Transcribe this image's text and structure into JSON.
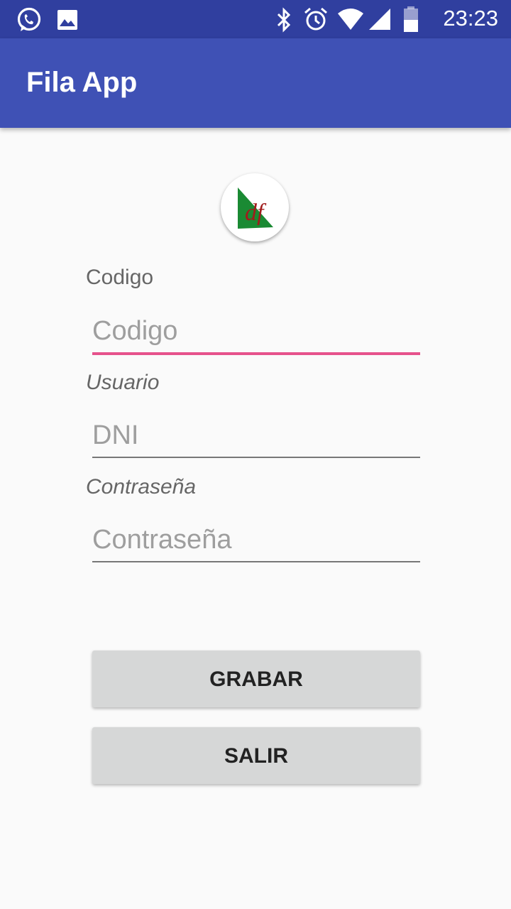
{
  "status_bar": {
    "time": "23:23",
    "icons": [
      "whatsapp-icon",
      "image-icon",
      "bluetooth-icon",
      "alarm-icon",
      "wifi-icon",
      "signal-icon",
      "battery-icon"
    ]
  },
  "app_bar": {
    "title": "Fila App"
  },
  "logo": {
    "letters": "df"
  },
  "form": {
    "codigo": {
      "label": "Codigo",
      "placeholder": "Codigo",
      "value": ""
    },
    "usuario": {
      "label": "Usuario",
      "placeholder": "DNI",
      "value": ""
    },
    "password": {
      "label": "Contraseña",
      "placeholder": "Contraseña",
      "value": ""
    }
  },
  "buttons": {
    "save": "GRABAR",
    "exit": "SALIR"
  },
  "colors": {
    "status_bar": "#303f9f",
    "app_bar": "#3f51b5",
    "accent": "#e6528c",
    "button_bg": "#d6d7d7",
    "logo_green": "#1a8a33",
    "logo_red": "#a11c1c"
  }
}
